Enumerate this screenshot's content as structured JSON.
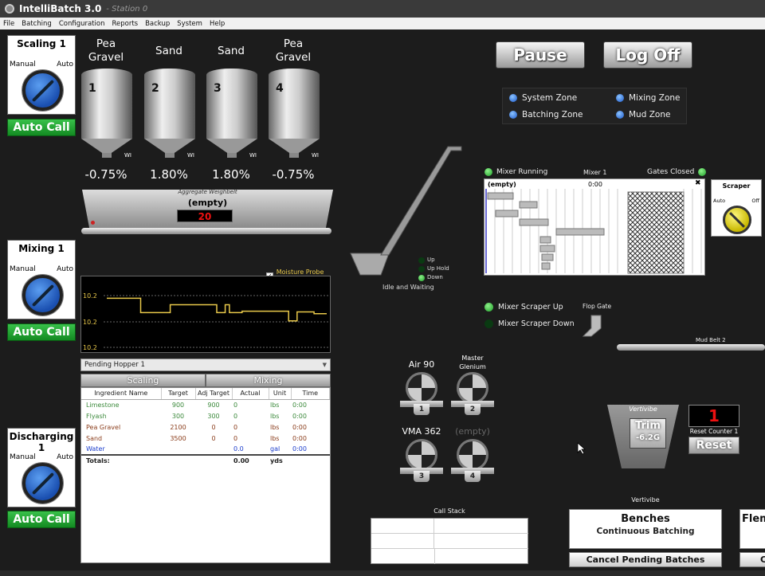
{
  "title_bar": {
    "app_name": "IntelliBatch 3.0",
    "station": "- Station 0"
  },
  "menu": [
    "File",
    "Batching",
    "Configuration",
    "Reports",
    "Backup",
    "System",
    "Help"
  ],
  "mode_panels": [
    {
      "title": "Scaling 1",
      "manual": "Manual",
      "auto": "Auto",
      "button": "Auto Call"
    },
    {
      "title": "Mixing 1",
      "manual": "Manual",
      "auto": "Auto",
      "button": "Auto Call"
    },
    {
      "title": "Discharging 1",
      "manual": "Manual",
      "auto": "Auto",
      "button": "Auto Call"
    }
  ],
  "hoppers": [
    {
      "name": "Pea Gravel",
      "number": "1",
      "wi": "WI",
      "percent": "-0.75%"
    },
    {
      "name": "Sand",
      "number": "2",
      "wi": "WI",
      "percent": "1.80%"
    },
    {
      "name": "Sand",
      "number": "3",
      "wi": "WI",
      "percent": "1.80%"
    },
    {
      "name": "Pea Gravel",
      "number": "4",
      "wi": "WI",
      "percent": "-0.75%"
    }
  ],
  "weighbelt": {
    "caption": "Aggregate Weighbelt",
    "status": "(empty)",
    "display": "20"
  },
  "moisture": {
    "checkbox_label": "Moisture Probe %",
    "checked": "✓",
    "y_labels": [
      "10.2",
      "10.2",
      "10.2"
    ]
  },
  "chart_data": {
    "type": "line",
    "title": "",
    "series": [
      {
        "values": [
          0.52,
          0.52,
          0.52,
          0.52,
          0.52,
          0.52,
          0.52,
          0.52,
          0.92,
          0.92,
          0.92,
          0.92,
          0.92,
          0.92,
          0.92,
          0.7,
          0.7,
          0.7,
          0.7,
          0.7,
          0.7,
          0.7,
          0.7,
          0.7,
          0.7,
          0.7,
          0.92,
          0.92,
          0.7,
          0.92,
          0.92,
          0.92,
          0.88,
          0.88,
          0.88,
          0.88,
          0.88,
          0.88,
          0.88,
          0.88,
          0.88,
          0.88,
          0.88,
          1.15,
          1.15,
          0.9,
          0.9,
          0.9,
          0.9,
          0.95,
          0.95,
          0.95,
          0.95
        ]
      }
    ],
    "ylim": [
      0,
      2
    ]
  },
  "pending": {
    "selector": "Pending Hopper 1",
    "tabs": [
      "Scaling",
      "Mixing"
    ],
    "columns": [
      "Ingredient Name",
      "Target",
      "Adj Target",
      "Actual",
      "Unit",
      "Time"
    ],
    "rows": [
      {
        "name": "Limestone",
        "target": "900",
        "adj": "900",
        "actual": "0",
        "unit": "lbs",
        "time": "0:00",
        "color": "#3c8a3c"
      },
      {
        "name": "Flyash",
        "target": "300",
        "adj": "300",
        "actual": "0",
        "unit": "lbs",
        "time": "0:00",
        "color": "#3c8a3c"
      },
      {
        "name": "Pea Gravel",
        "target": "2100",
        "adj": "0",
        "actual": "0",
        "unit": "lbs",
        "time": "0:00",
        "color": "#8a3c1a"
      },
      {
        "name": "Sand",
        "target": "3500",
        "adj": "0",
        "actual": "0",
        "unit": "lbs",
        "time": "0:00",
        "color": "#8a3c1a"
      },
      {
        "name": "Water",
        "target": "",
        "adj": "",
        "actual": "0.0",
        "unit": "gal",
        "time": "0:00",
        "color": "#1a3ccc"
      }
    ],
    "totals": {
      "label": "Totals:",
      "actual": "0.00",
      "unit": "yds"
    }
  },
  "buttons": {
    "pause": "Pause",
    "logoff": "Log Off"
  },
  "zones": [
    "System Zone",
    "Mixing Zone",
    "Batching Zone",
    "Mud Zone"
  ],
  "conveyor": {
    "up": "Up",
    "uphold": "Up Hold",
    "down": "Down",
    "status": "Idle and Waiting"
  },
  "mixer": {
    "running": "Mixer Running",
    "name": "Mixer 1",
    "gates": "Gates Closed",
    "status": "(empty)",
    "time": "0:00",
    "pin": "📌",
    "scraper_title": "Scraper",
    "scraper_auto": "Auto",
    "scraper_off": "Off",
    "scraper_up": "Mixer Scraper Up",
    "scraper_down": "Mixer Scraper Down",
    "flop_gate": "Flop Gate",
    "mud_belt": "Mud Belt 2"
  },
  "pumps": [
    {
      "label": "Air 90",
      "number": "1"
    },
    {
      "label": "Master Glenium",
      "number": "2"
    },
    {
      "label": "VMA 362",
      "number": "3"
    },
    {
      "label": "(empty)",
      "number": "4"
    }
  ],
  "vertivibe": {
    "title": "Vertivibe",
    "trim": "Trim",
    "trim_value": "-6.2G",
    "counter": "1",
    "reset_label": "Reset Counter 1",
    "reset": "Reset",
    "label2": "Vertivibe"
  },
  "call_stack": {
    "label": "Call Stack"
  },
  "benches": {
    "title": "Benches",
    "subtitle": "Continuous Batching",
    "cancel": "Cancel Pending Batches",
    "next": "Flem",
    "next_btn": "C"
  }
}
